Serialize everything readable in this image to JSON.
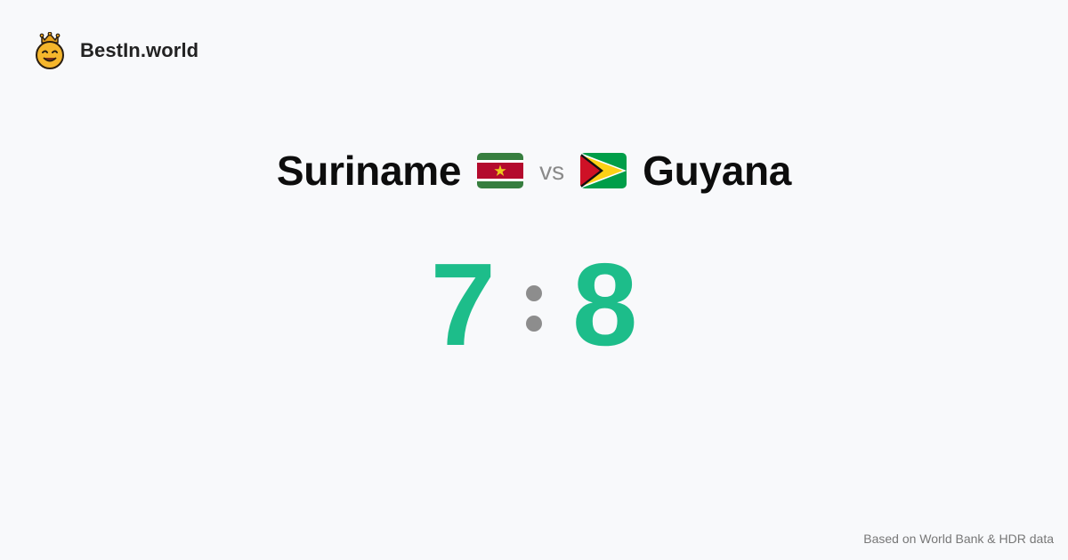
{
  "brand": {
    "logo_icon": "crowned-smiley-icon",
    "name": "BestIn.world"
  },
  "matchup": {
    "left_country": "Suriname",
    "left_flag_icon": "suriname-flag-icon",
    "vs_label": "vs",
    "right_country": "Guyana",
    "right_flag_icon": "guyana-flag-icon"
  },
  "score": {
    "left": "7",
    "right": "8",
    "color": "#1dbd8a"
  },
  "footer": {
    "note": "Based on World Bank & HDR data"
  }
}
